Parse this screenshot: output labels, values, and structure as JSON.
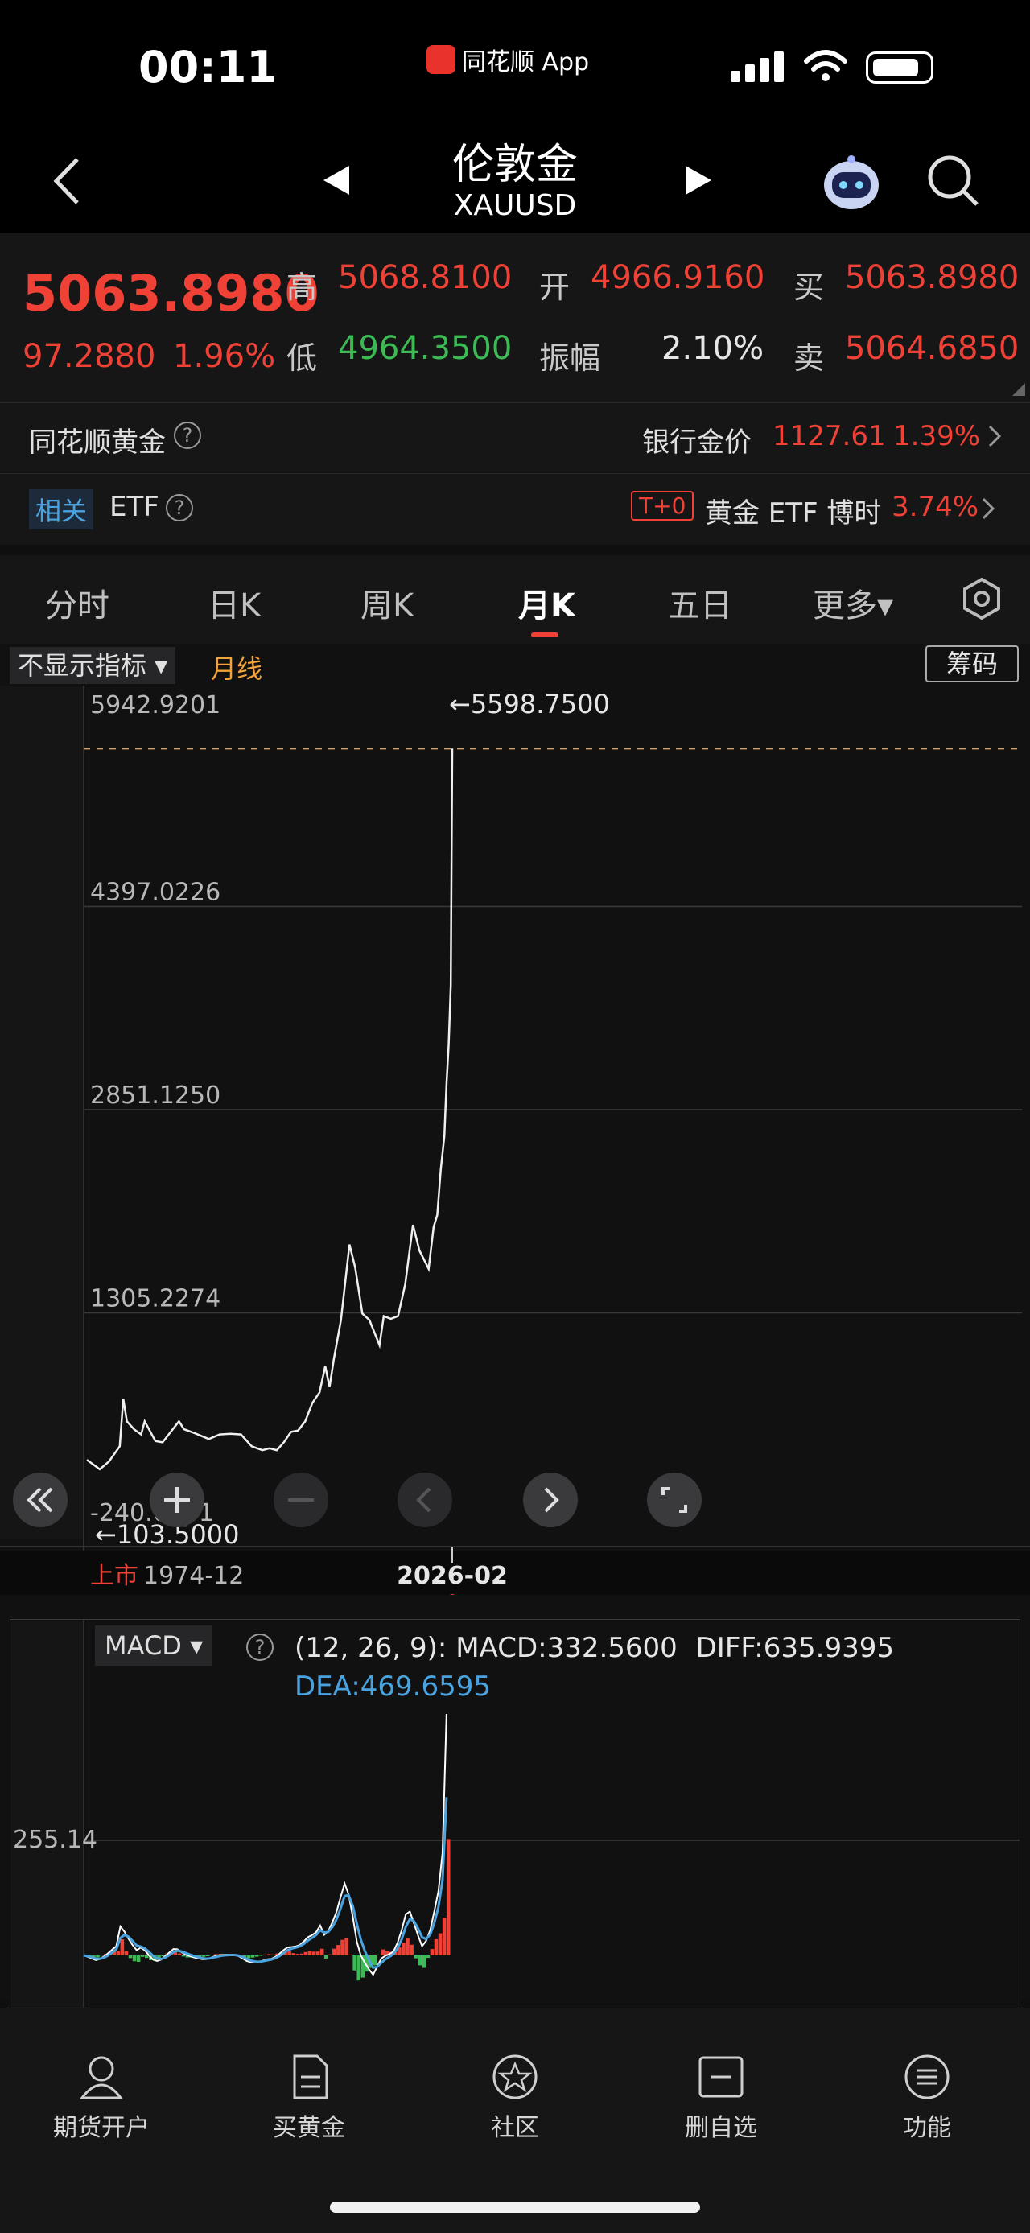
{
  "status": {
    "time": "00:11",
    "app_name": "同花顺 App"
  },
  "header": {
    "title": "伦敦金",
    "symbol": "XAUUSD"
  },
  "quote": {
    "price": "5063.8980",
    "change": "97.2880",
    "change_pct": "1.96%",
    "high_label": "高",
    "high": "5068.8100",
    "low_label": "低",
    "low": "4964.3500",
    "open_label": "开",
    "open": "4966.9160",
    "amp_label": "振幅",
    "amp": "2.10%",
    "buy_label": "买",
    "buy": "5063.8980",
    "sell_label": "卖",
    "sell": "5064.6850"
  },
  "gold_row": {
    "label": "同花顺黄金",
    "help_icon": "?",
    "bank_label": "银行金价",
    "bank_price": "1127.61",
    "bank_pct": "1.39%"
  },
  "etf_row": {
    "related": "相关",
    "etf": "ETF",
    "help_icon": "?",
    "t0": "T+0",
    "etf_name": "黄金 ETF 博时",
    "etf_pct": "3.74%"
  },
  "tabs": [
    "分时",
    "日K",
    "周K",
    "月K",
    "五日",
    "更多▾"
  ],
  "active_tab": 3,
  "chart_toolbar": {
    "indicator": "不显示指标 ▾",
    "line_type": "月线",
    "chip_button": "筹码"
  },
  "chart_data": {
    "type": "line",
    "title": "",
    "y_ticks": [
      "5942.9201",
      "4397.0226",
      "2851.1250",
      "1305.2274",
      "-240.6701"
    ],
    "ylim": [
      -240.6701,
      5942.9201
    ],
    "max_annotation": "←5598.7500",
    "min_annotation": "←103.5000",
    "x_start_label": "上市",
    "x_start": "1974-12",
    "x_end": "2026-02",
    "series": [
      {
        "x": [
          1974.9,
          1976.7,
          1978.0,
          1979.5,
          1980.0,
          1980.5,
          1981.5,
          1982.5,
          1983.0,
          1984.5,
          1985.5,
          1986.5,
          1987.8,
          1988.5,
          1990.0,
          1992.0,
          1993.5,
          1995.0,
          1996.5,
          1998.0,
          1999.5,
          2000.5,
          2001.5,
          2002.5,
          2003.5,
          2004.5,
          2005.5,
          2006.5,
          2007.5,
          2008.3,
          2008.9,
          2009.5,
          2010.5,
          2011.7,
          2012.5,
          2013.5,
          2014.5,
          2015.9,
          2016.5,
          2017.5,
          2018.5,
          2019.5,
          2020.6,
          2021.5,
          2022.8,
          2023.5,
          2024.0,
          2024.5,
          2025.0,
          2025.3,
          2025.6,
          2025.9,
          2026.1
        ],
        "y": [
          187,
          115,
          175,
          290,
          650,
          480,
          420,
          380,
          480,
          330,
          320,
          390,
          480,
          420,
          390,
          345,
          380,
          385,
          380,
          290,
          260,
          275,
          260,
          320,
          400,
          410,
          480,
          620,
          700,
          900,
          740,
          950,
          1250,
          1825,
          1650,
          1300,
          1250,
          1060,
          1280,
          1260,
          1280,
          1520,
          1975,
          1780,
          1640,
          1960,
          2050,
          2400,
          2650,
          3050,
          3350,
          3800,
          5598
        ]
      }
    ],
    "macd": {
      "label": "MACD ▾",
      "params": "(12, 26, 9)",
      "macd_label": "MACD:",
      "macd_value": "332.5600",
      "diff_label": "DIFF:",
      "diff_value": "635.9395",
      "dea_label": "DEA:",
      "dea_value": "469.6595",
      "y_tick": "255.14",
      "colors": {
        "diff": "#ffffff",
        "dea": "#4aa3df",
        "pos": "#ef4136",
        "neg": "#3cba54"
      }
    }
  },
  "bottom_nav": [
    "期货开户",
    "买黄金",
    "社区",
    "删自选",
    "功能"
  ],
  "colors": {
    "up": "#ef4136",
    "down": "#3cba54",
    "accent": "#ef4136",
    "blue": "#4aa3df"
  }
}
